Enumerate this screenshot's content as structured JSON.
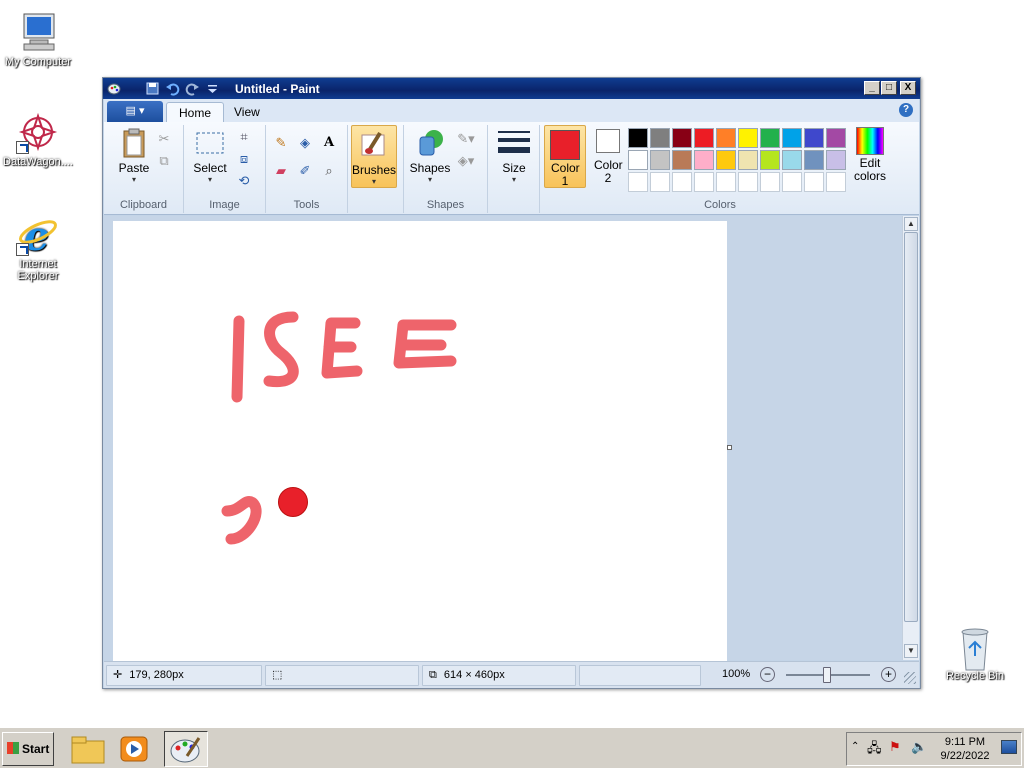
{
  "desktop": {
    "icons": [
      {
        "label": "My Computer",
        "icon": "computer-icon"
      },
      {
        "label": "DataWagon....",
        "icon": "datawagon-icon"
      },
      {
        "label": "Internet Explorer",
        "icon": "internet-explorer-icon"
      },
      {
        "label": "Recycle Bin",
        "icon": "recycle-bin-icon"
      }
    ]
  },
  "window": {
    "title": "Untitled - Paint",
    "controls": {
      "minimize": "_",
      "maximize": "□",
      "close": "X"
    }
  },
  "ribbon": {
    "file_menu": "▤ ▾",
    "tabs": [
      {
        "label": "Home",
        "active": true
      },
      {
        "label": "View",
        "active": false
      }
    ],
    "help": "?",
    "groups": {
      "clipboard": {
        "label": "Clipboard",
        "paste": "Paste"
      },
      "image": {
        "label": "Image",
        "select": "Select"
      },
      "tools": {
        "label": "Tools",
        "text_tool": "A"
      },
      "brushes": {
        "label": "Brushes"
      },
      "shapes": {
        "label": "Shapes",
        "shapes_button": "Shapes"
      },
      "size": {
        "label": "Size"
      },
      "colors": {
        "label": "Colors",
        "color1": {
          "label": "Color 1",
          "value": "#e8202a"
        },
        "color2": {
          "label": "Color 2",
          "value": "#ffffff"
        },
        "edit_colors": "Edit colors",
        "palette_row1": [
          "#000000",
          "#7f7f7f",
          "#880015",
          "#ed1c24",
          "#ff7f27",
          "#fff200",
          "#22b14c",
          "#00a2e8",
          "#3f48cc",
          "#a349a4"
        ],
        "palette_row2": [
          "#ffffff",
          "#c3c3c3",
          "#b97a57",
          "#ffaec9",
          "#ffc90e",
          "#efe4b0",
          "#b5e61d",
          "#99d9ea",
          "#7092be",
          "#c8bfe7"
        ],
        "palette_row3": [
          "#ffffff",
          "#ffffff",
          "#ffffff",
          "#ffffff",
          "#ffffff",
          "#ffffff",
          "#ffffff",
          "#ffffff",
          "#ffffff",
          "#ffffff"
        ]
      }
    }
  },
  "canvas": {
    "drawing_text": "ISEE",
    "stroke_color": "#e8303a"
  },
  "status": {
    "cursor_position": "179, 280px",
    "selection_size": "",
    "image_size": "614 × 460px",
    "zoom": "100%",
    "zoom_out": "−",
    "zoom_in": "+"
  },
  "taskbar": {
    "start": "Start",
    "clock_time": "9:11 PM",
    "clock_date": "9/22/2022"
  }
}
